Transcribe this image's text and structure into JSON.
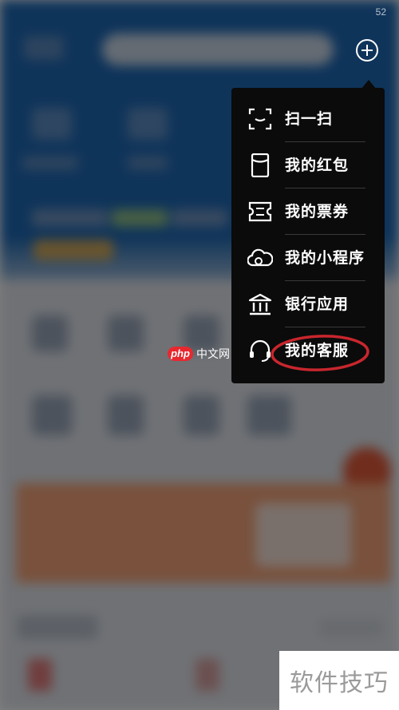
{
  "status_bar": {
    "time": "52"
  },
  "menu": {
    "items": [
      {
        "id": "scan",
        "label": "扫一扫",
        "icon": "scan-icon"
      },
      {
        "id": "red-packet",
        "label": "我的红包",
        "icon": "red-packet-icon"
      },
      {
        "id": "tickets",
        "label": "我的票券",
        "icon": "ticket-icon"
      },
      {
        "id": "mini-programs",
        "label": "我的小程序",
        "icon": "cloud-icon"
      },
      {
        "id": "bank-apps",
        "label": "银行应用",
        "icon": "bank-icon"
      },
      {
        "id": "customer-service",
        "label": "我的客服",
        "icon": "headset-icon"
      }
    ],
    "highlighted_item": "customer-service",
    "highlight_color": "#c8262d"
  },
  "watermarks": {
    "php_pill": "php",
    "php_text": "中文网",
    "corner": "软件技巧"
  }
}
